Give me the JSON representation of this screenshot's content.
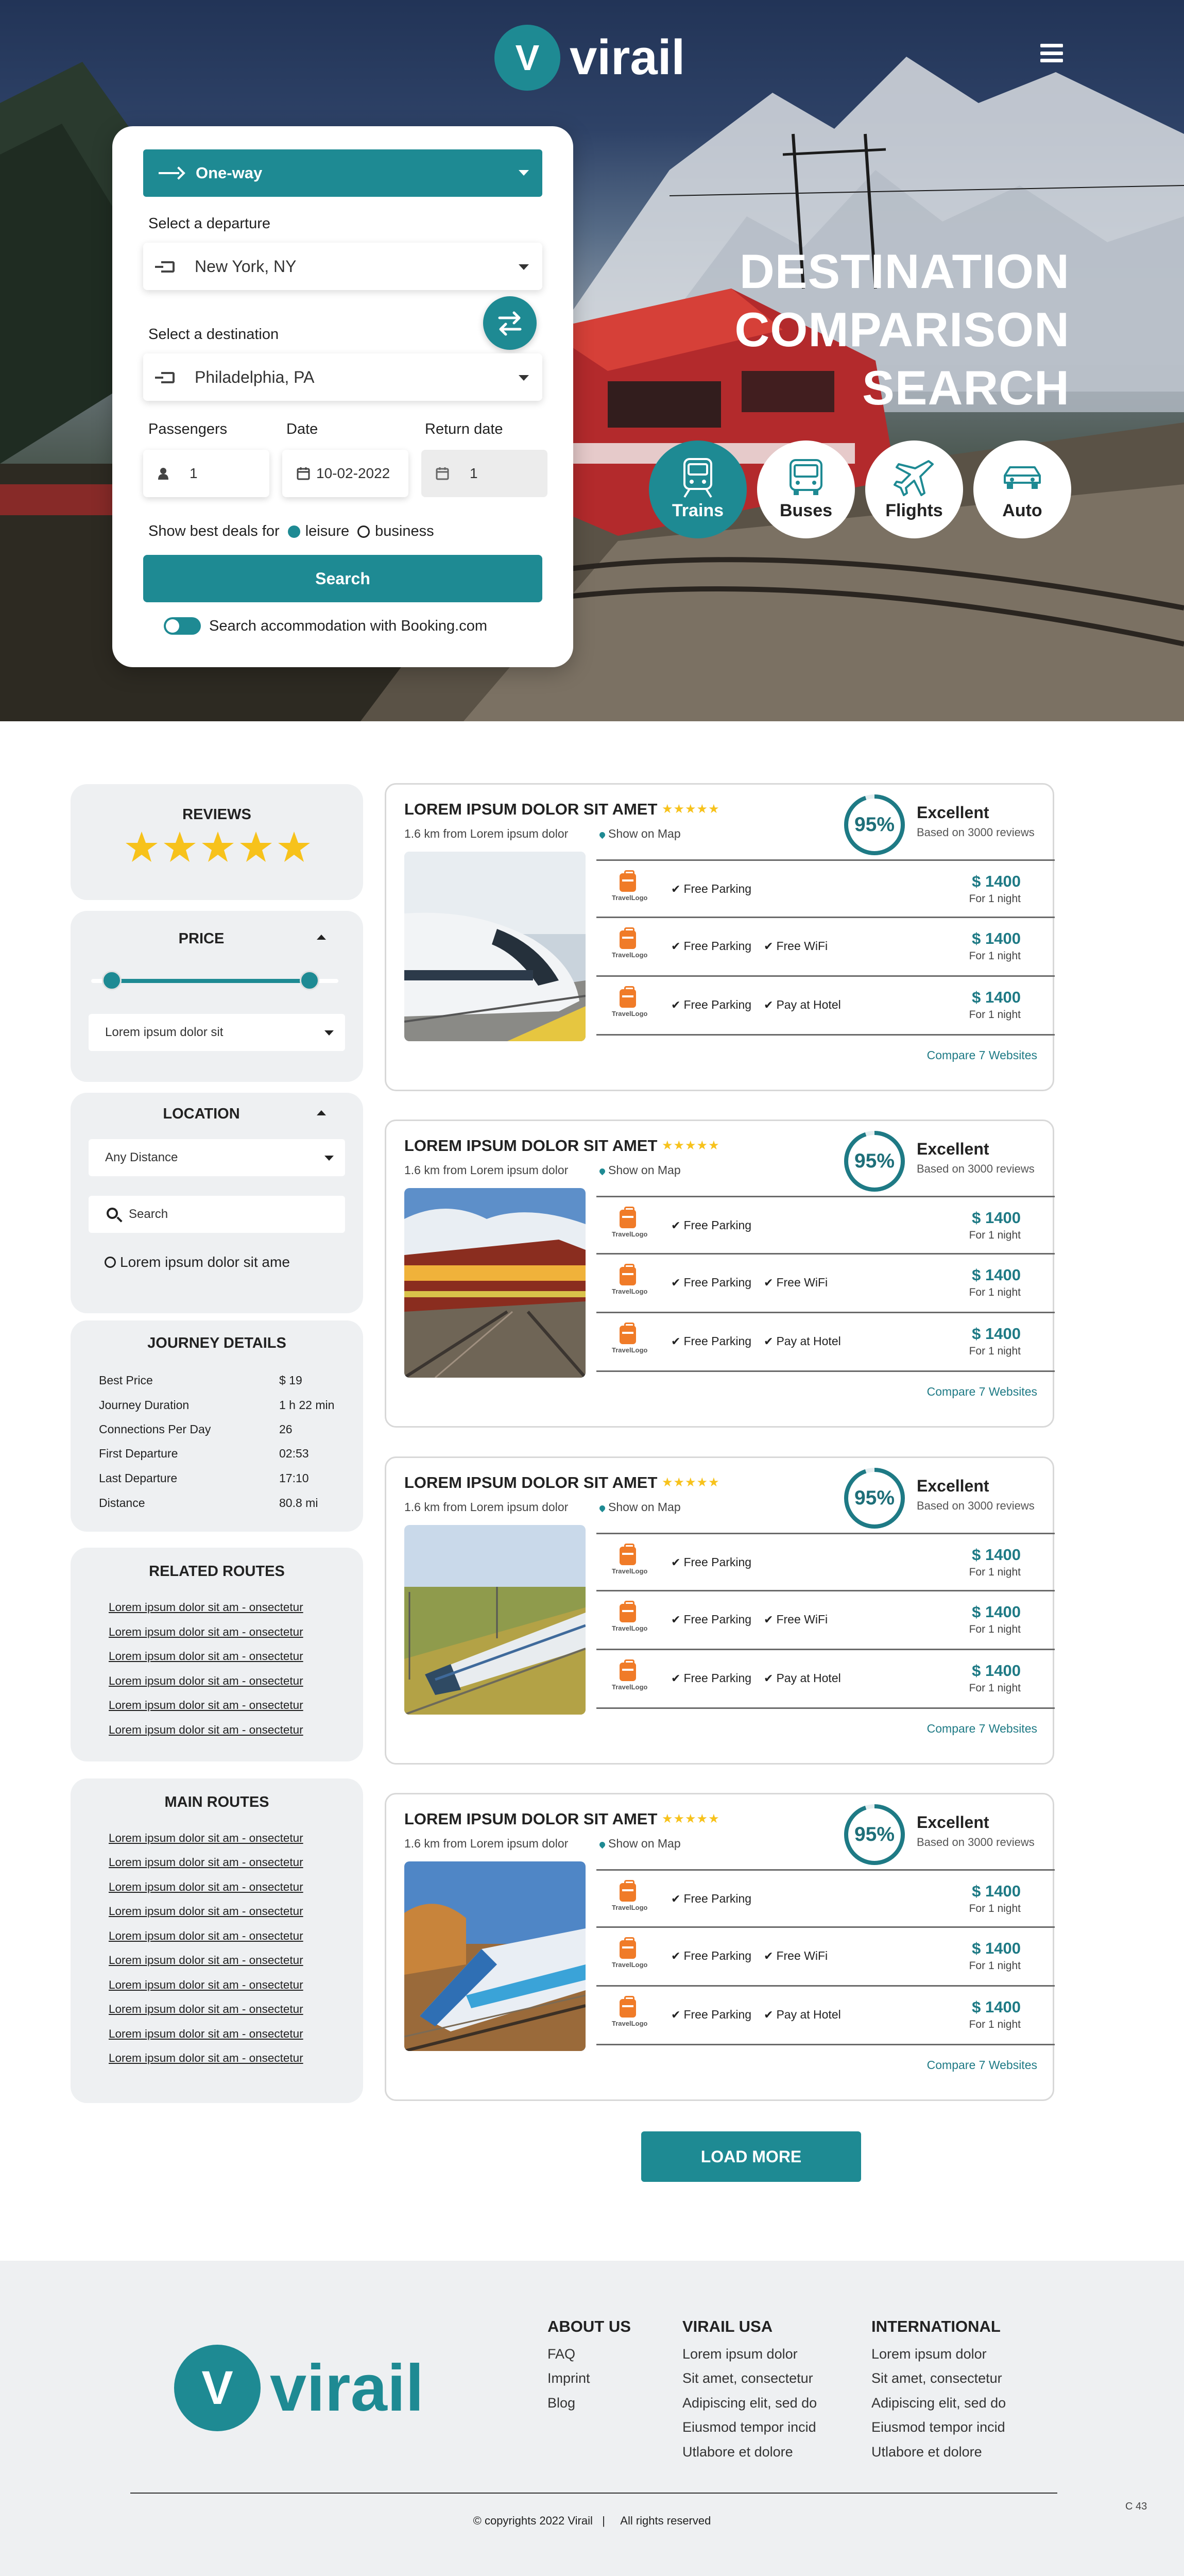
{
  "brand": {
    "name": "virail",
    "mark": "V",
    "color": "#1e8a93"
  },
  "search": {
    "trip_type": "One-way",
    "departure_label": "Select a departure",
    "departure_value": "New York, NY",
    "destination_label": "Select a destination",
    "destination_value": "Philadelphia, PA",
    "passengers_label": "Passengers",
    "passengers_value": "1",
    "date_label": "Date",
    "date_value": "10-02-2022",
    "return_label": "Return date",
    "return_value": "1",
    "deals_label": "Show best deals for",
    "deal_options": [
      "leisure",
      "business"
    ],
    "deal_selected": "leisure",
    "search_button": "Search",
    "accommodation_label": "Search accommodation with Booking.com"
  },
  "hero": {
    "title_lines": [
      "DESTINATION",
      "COMPARISON",
      "SEARCH"
    ],
    "modes": [
      {
        "label": "Trains",
        "icon": "train-icon",
        "active": true
      },
      {
        "label": "Buses",
        "icon": "bus-icon",
        "active": false
      },
      {
        "label": "Flights",
        "icon": "plane-icon",
        "active": false
      },
      {
        "label": "Auto",
        "icon": "car-icon",
        "active": false
      }
    ]
  },
  "filters": {
    "reviews_title": "REVIEWS",
    "reviews_stars": 5,
    "price_title": "PRICE",
    "price_dropdown": "Lorem ipsum dolor sit",
    "location_title": "LOCATION",
    "distance_dropdown": "Any Distance",
    "search_placeholder": "Search",
    "location_option": "Lorem ipsum dolor sit ame"
  },
  "journey": {
    "title": "JOURNEY DETAILS",
    "rows": [
      {
        "label": "Best Price",
        "value": "$ 19"
      },
      {
        "label": "Journey Duration",
        "value": "1 h 22 min"
      },
      {
        "label": "Connections Per Day",
        "value": "26"
      },
      {
        "label": "First Departure",
        "value": "02:53"
      },
      {
        "label": "Last Departure",
        "value": "17:10"
      },
      {
        "label": "Distance",
        "value": "80.8 mi"
      }
    ]
  },
  "related_routes": {
    "title": "RELATED ROUTES",
    "links": [
      "Lorem ipsum dolor sit am - onsectetur",
      "Lorem ipsum dolor sit am - onsectetur",
      "Lorem ipsum dolor sit am - onsectetur",
      "Lorem ipsum dolor sit am - onsectetur",
      "Lorem ipsum dolor sit am - onsectetur",
      "Lorem ipsum dolor sit am - onsectetur"
    ]
  },
  "main_routes": {
    "title": "MAIN ROUTES",
    "links": [
      "Lorem ipsum dolor sit am - onsectetur",
      "Lorem ipsum dolor sit am - onsectetur",
      "Lorem ipsum dolor sit am - onsectetur",
      "Lorem ipsum dolor sit am - onsectetur",
      "Lorem ipsum dolor sit am - onsectetur",
      "Lorem ipsum dolor sit am - onsectetur",
      "Lorem ipsum dolor sit am - onsectetur",
      "Lorem ipsum dolor sit am - onsectetur",
      "Lorem ipsum dolor sit am - onsectetur",
      "Lorem ipsum dolor sit am - onsectetur"
    ]
  },
  "results": [
    {
      "title": "LOREM IPSUM DOLOR SIT AMET",
      "stars": "★★★★★",
      "distance": "1.6 km from Lorem ipsum dolor",
      "show_map": "Show on Map",
      "score": "95%",
      "rating": "Excellent",
      "based": "Based on 3000 reviews",
      "compare": "Compare 7 Websites",
      "deals": [
        {
          "features": [
            "Free Parking"
          ],
          "price": "$ 1400",
          "per": "For 1 night",
          "logo": "TravelLogo"
        },
        {
          "features": [
            "Free Parking",
            "Free WiFi"
          ],
          "price": "$ 1400",
          "per": "For 1 night",
          "logo": "TravelLogo"
        },
        {
          "features": [
            "Free Parking",
            "Pay at Hotel"
          ],
          "price": "$ 1400",
          "per": "For 1 night",
          "logo": "TravelLogo"
        }
      ]
    },
    {
      "title": "LOREM IPSUM DOLOR SIT AMET",
      "stars": "★★★★★",
      "distance": "1.6 km from Lorem ipsum dolor",
      "show_map": "Show on Map",
      "score": "95%",
      "rating": "Excellent",
      "based": "Based on 3000 reviews",
      "compare": "Compare 7 Websites",
      "deals": [
        {
          "features": [
            "Free Parking"
          ],
          "price": "$ 1400",
          "per": "For 1 night",
          "logo": "TravelLogo"
        },
        {
          "features": [
            "Free Parking",
            "Free WiFi"
          ],
          "price": "$ 1400",
          "per": "For 1 night",
          "logo": "TravelLogo"
        },
        {
          "features": [
            "Free Parking",
            "Pay at Hotel"
          ],
          "price": "$ 1400",
          "per": "For 1 night",
          "logo": "TravelLogo"
        }
      ]
    },
    {
      "title": "LOREM IPSUM DOLOR SIT AMET",
      "stars": "★★★★★",
      "distance": "1.6 km from Lorem ipsum dolor",
      "show_map": "Show on Map",
      "score": "95%",
      "rating": "Excellent",
      "based": "Based on 3000 reviews",
      "compare": "Compare 7 Websites",
      "deals": [
        {
          "features": [
            "Free Parking"
          ],
          "price": "$ 1400",
          "per": "For 1 night",
          "logo": "TravelLogo"
        },
        {
          "features": [
            "Free Parking",
            "Free WiFi"
          ],
          "price": "$ 1400",
          "per": "For 1 night",
          "logo": "TravelLogo"
        },
        {
          "features": [
            "Free Parking",
            "Pay at Hotel"
          ],
          "price": "$ 1400",
          "per": "For 1 night",
          "logo": "TravelLogo"
        }
      ]
    },
    {
      "title": "LOREM IPSUM DOLOR SIT AMET",
      "stars": "★★★★★",
      "distance": "1.6 km from Lorem ipsum dolor",
      "show_map": "Show on Map",
      "score": "95%",
      "rating": "Excellent",
      "based": "Based on 3000 reviews",
      "compare": "Compare 7 Websites",
      "deals": [
        {
          "features": [
            "Free Parking"
          ],
          "price": "$ 1400",
          "per": "For 1 night",
          "logo": "TravelLogo"
        },
        {
          "features": [
            "Free Parking",
            "Free WiFi"
          ],
          "price": "$ 1400",
          "per": "For 1 night",
          "logo": "TravelLogo"
        },
        {
          "features": [
            "Free Parking",
            "Pay at Hotel"
          ],
          "price": "$ 1400",
          "per": "For 1 night",
          "logo": "TravelLogo"
        }
      ]
    }
  ],
  "load_more": "LOAD MORE",
  "footer": {
    "about_title": "ABOUT US",
    "about_links": [
      "FAQ",
      "Imprint",
      "Blog"
    ],
    "usa_title": "VIRAIL USA",
    "usa_links": [
      "Lorem ipsum dolor",
      "Sit amet, consectetur",
      "Adipiscing elit, sed do",
      "Eiusmod tempor incid",
      "Utlabore et dolore"
    ],
    "intl_title": "INTERNATIONAL",
    "intl_links": [
      "Lorem ipsum dolor",
      "Sit amet, consectetur",
      "Adipiscing elit, sed do",
      "Eiusmod tempor incid",
      "Utlabore et dolore"
    ],
    "copyright": "© copyrights 2022 Virail   |     All rights reserved",
    "corner": "C 43"
  }
}
